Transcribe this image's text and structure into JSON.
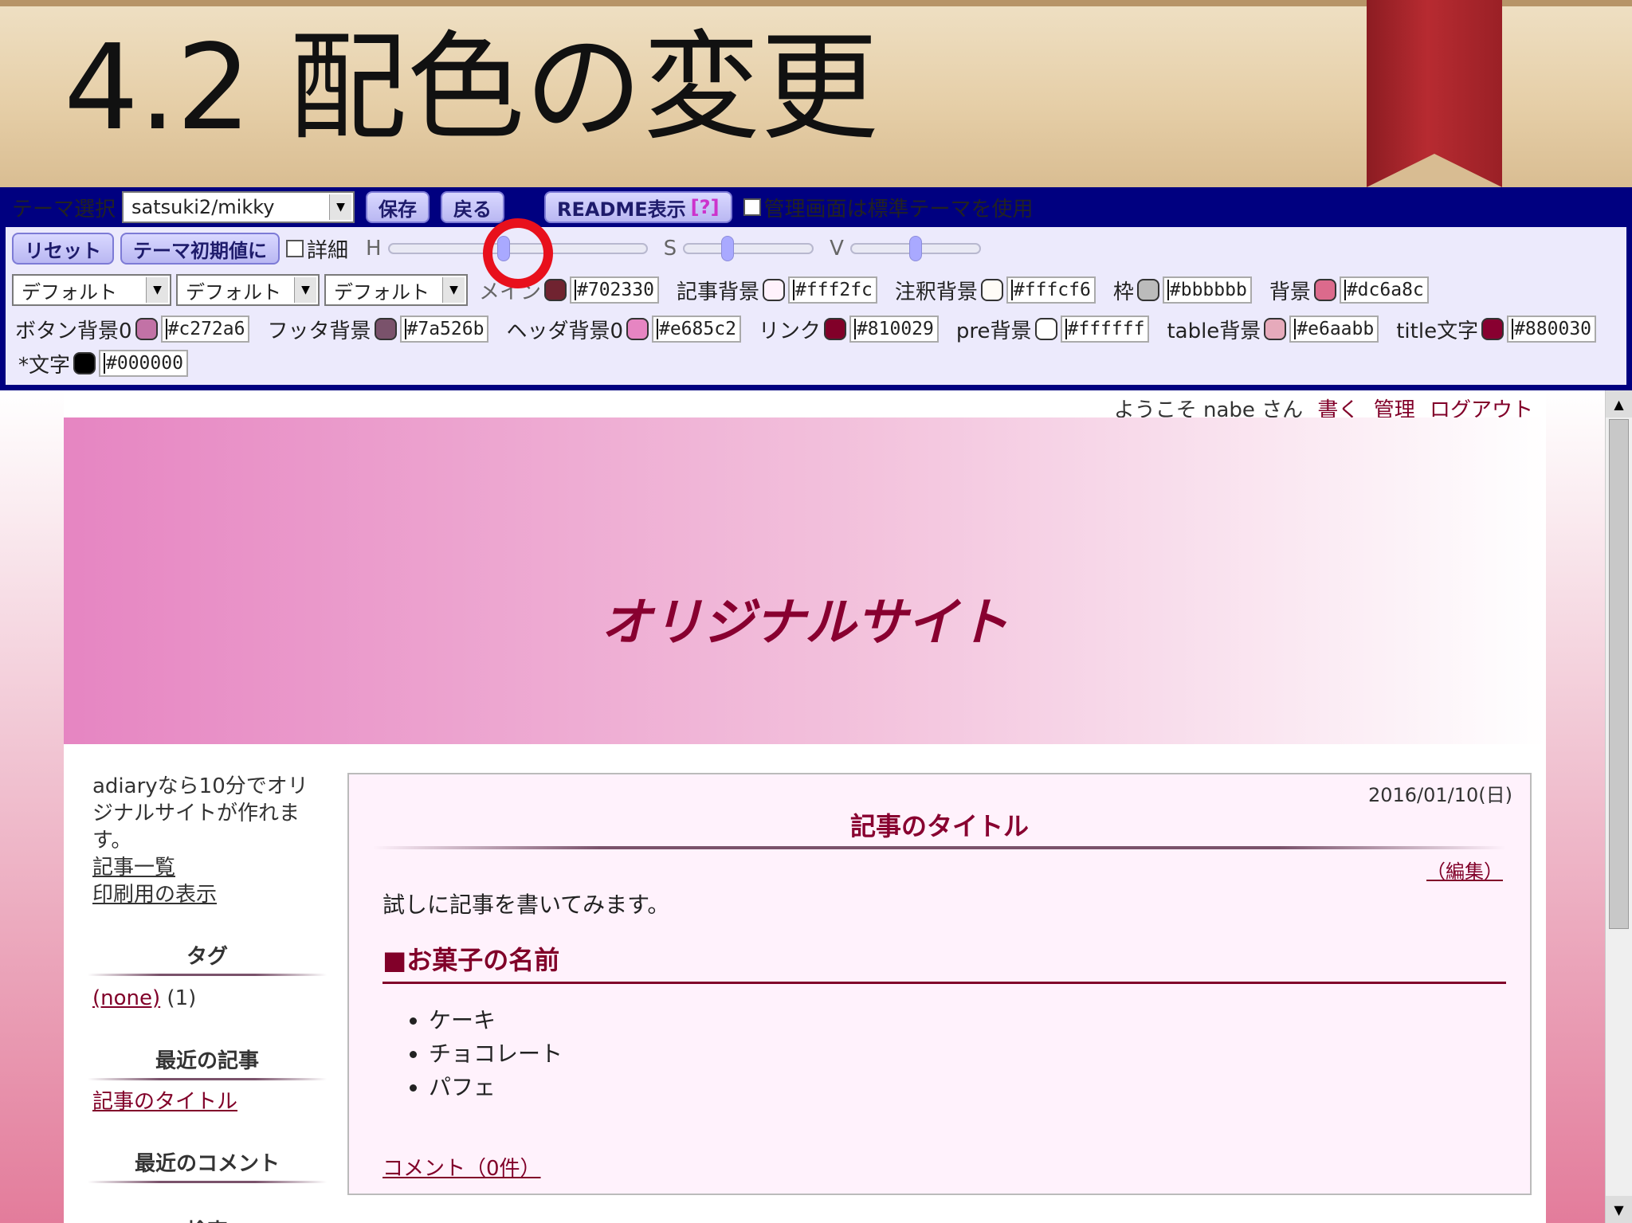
{
  "slide": {
    "title": "4.2 配色の変更"
  },
  "toolbar": {
    "theme_select_label": "テーマ選択",
    "theme_value": "satsuki2/mikky",
    "save_label": "保存",
    "back_label": "戻る",
    "readme_label": "README表示",
    "readme_help": "[?]",
    "admin_standard_theme_label": "管理画面は標準テーマを使用",
    "reset_label": "リセット",
    "theme_default_label": "テーマ初期値に",
    "detail_label": "詳細",
    "h_label": "H",
    "s_label": "S",
    "v_label": "V",
    "sliders": {
      "h": 0.44,
      "s": 0.32,
      "v": 0.5
    },
    "font_selects": [
      "デフォルト",
      "デフォルト",
      "デフォルト"
    ]
  },
  "colors": [
    {
      "label": "メイン",
      "hex": "#702330"
    },
    {
      "label": "記事背景",
      "hex": "#fff2fc"
    },
    {
      "label": "注釈背景",
      "hex": "#fffcf6"
    },
    {
      "label": "枠",
      "hex": "#bbbbbb"
    },
    {
      "label": "背景",
      "hex": "#dc6a8c"
    },
    {
      "label": "ボタン背景0",
      "hex": "#c272a6"
    },
    {
      "label": "フッタ背景",
      "hex": "#7a526b"
    },
    {
      "label": "ヘッダ背景0",
      "hex": "#e685c2"
    },
    {
      "label": "リンク",
      "hex": "#810029"
    },
    {
      "label": "pre背景",
      "hex": "#ffffff"
    },
    {
      "label": "table背景",
      "hex": "#e6aabb"
    },
    {
      "label": "title文字",
      "hex": "#880030"
    },
    {
      "label": "*文字",
      "hex": "#000000"
    }
  ],
  "userbar": {
    "greeting": "ようこそ nabe さん",
    "write": "書く",
    "admin": "管理",
    "logout": "ログアウト"
  },
  "site": {
    "title": "オリジナルサイト"
  },
  "sidebar": {
    "intro": "adiaryなら10分でオリジナルサイトが作れます。",
    "link_list": "記事一覧",
    "link_print": "印刷用の表示",
    "tag_heading": "タグ",
    "tag_none": "(none)",
    "tag_count": "(1)",
    "recent_heading": "最近の記事",
    "recent_item": "記事のタイトル",
    "comments_heading": "最近のコメント",
    "search_heading": "検索"
  },
  "article": {
    "date": "2016/01/10(日)",
    "title": "記事のタイトル",
    "edit": "（編集）",
    "body": "試しに記事を書いてみます。",
    "heading": "■お菓子の名前",
    "items": [
      "ケーキ",
      "チョコレート",
      "パフェ"
    ],
    "comment": "コメント（0件）"
  }
}
